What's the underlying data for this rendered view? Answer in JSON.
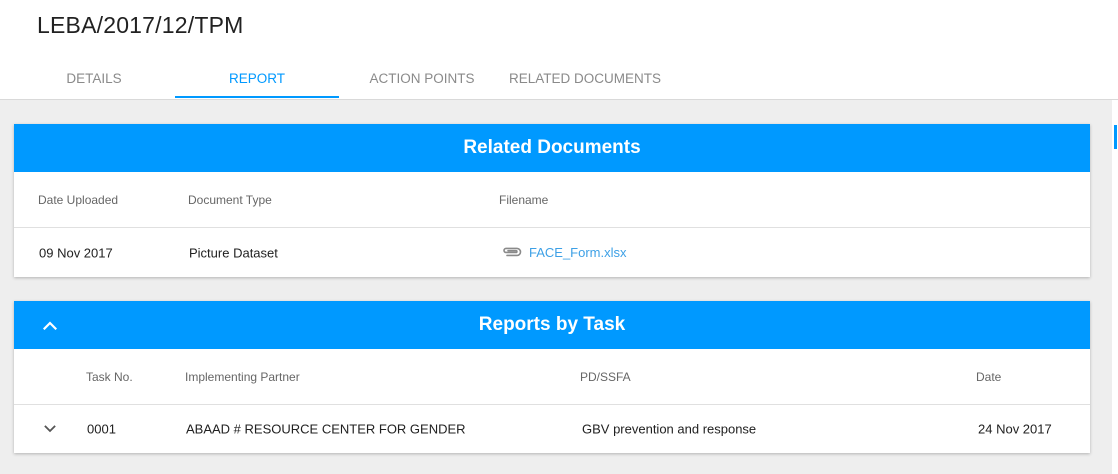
{
  "page": {
    "title": "LEBA/2017/12/TPM"
  },
  "tabs": [
    {
      "label": "DETAILS"
    },
    {
      "label": "REPORT"
    },
    {
      "label": "ACTION POINTS"
    },
    {
      "label": "RELATED DOCUMENTS"
    }
  ],
  "active_tab": "REPORT",
  "colors": {
    "accent": "#0099ff",
    "link": "#3da0e6"
  },
  "related_documents": {
    "title": "Related Documents",
    "columns": {
      "date_uploaded": "Date Uploaded",
      "document_type": "Document Type",
      "filename": "Filename"
    },
    "rows": [
      {
        "date_uploaded": "09 Nov 2017",
        "document_type": "Picture Dataset",
        "filename": "FACE_Form.xlsx",
        "icon": "paperclip-icon"
      }
    ]
  },
  "reports_by_task": {
    "title": "Reports by Task",
    "collapse_icon": "chevron-up-icon",
    "columns": {
      "task_no": "Task No.",
      "implementing_partner": "Implementing Partner",
      "pd_ssfa": "PD/SSFA",
      "date": "Date"
    },
    "rows": [
      {
        "task_no": "0001",
        "implementing_partner": "ABAAD # RESOURCE CENTER FOR GENDER",
        "pd_ssfa": "GBV prevention and response",
        "date": "24 Nov 2017",
        "expand_icon": "chevron-down-icon"
      }
    ]
  }
}
